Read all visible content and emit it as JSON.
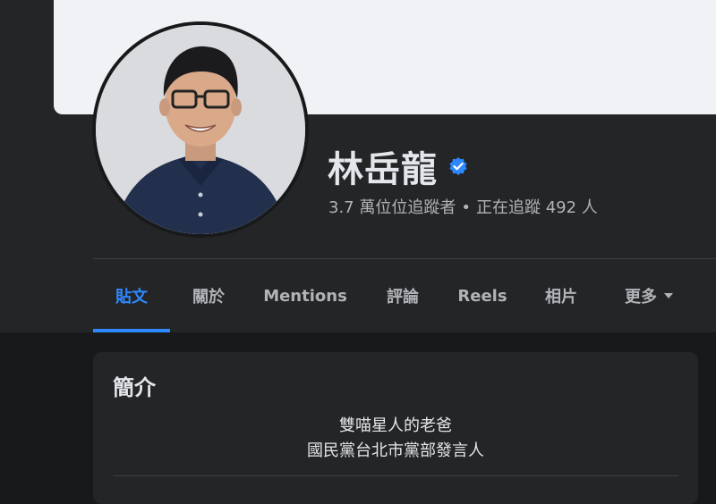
{
  "profile": {
    "name": "林岳龍",
    "verified_icon": "verified-badge-icon",
    "followers": "3.7 萬位位追蹤者",
    "separator": "•",
    "following": "正在追蹤 492 人"
  },
  "tabs": [
    {
      "label": "貼文",
      "active": true
    },
    {
      "label": "關於",
      "active": false
    },
    {
      "label": "Mentions",
      "active": false
    },
    {
      "label": "評論",
      "active": false
    },
    {
      "label": "Reels",
      "active": false
    },
    {
      "label": "相片",
      "active": false
    },
    {
      "label": "更多",
      "active": false
    }
  ],
  "intro": {
    "title": "簡介",
    "bio_line1": "雙喵星人的老爸",
    "bio_line2": "國民黨台北市黨部發言人"
  },
  "colors": {
    "accent": "#2d88ff",
    "background": "#18191a",
    "surface": "#242526",
    "cover": "#f0f2f5"
  }
}
